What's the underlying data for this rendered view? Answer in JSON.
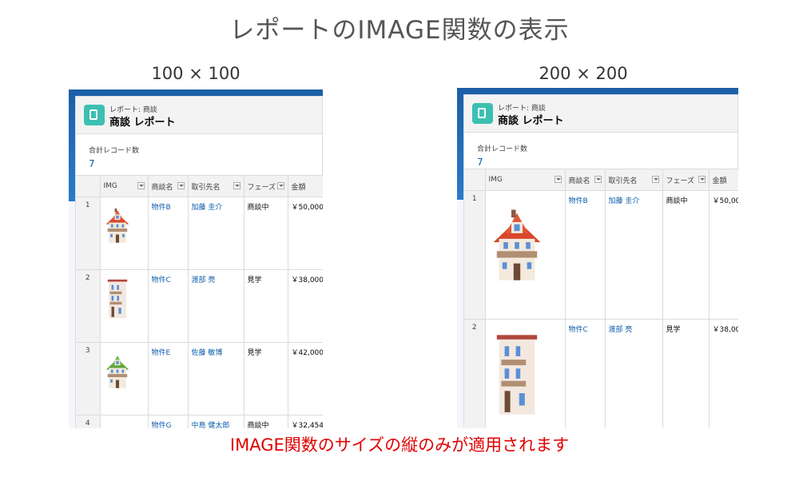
{
  "page": {
    "title": "レポートのIMAGE関数の表示",
    "note": "IMAGE関数のサイズの縦のみが適用されます"
  },
  "panels": [
    {
      "label": "100 × 100",
      "eyebrow": "レポート: 商談",
      "title": "商談 レポート",
      "summary_label": "合計レコード数",
      "summary_value": "7",
      "columns": [
        "IMG",
        "商談名",
        "取引先名",
        "フェーズ",
        "金額"
      ],
      "rows": [
        {
          "no": "1",
          "name": "物件B",
          "account": "加藤 圭介",
          "phase": "商談中",
          "amount": "￥50,000,",
          "house": "red"
        },
        {
          "no": "2",
          "name": "物件C",
          "account": "渡部 亮",
          "phase": "見学",
          "amount": "￥38,000,",
          "house": "tall"
        },
        {
          "no": "3",
          "name": "物件E",
          "account": "佐藤 敏博",
          "phase": "見学",
          "amount": "￥42,000,",
          "house": "green"
        },
        {
          "no": "4",
          "name": "物件G",
          "account": "中島 健太郎",
          "phase": "商談中",
          "amount": "￥32,454,",
          "house": "blue"
        }
      ]
    },
    {
      "label": "200 × 200",
      "eyebrow": "レポート: 商談",
      "title": "商談 レポート",
      "summary_label": "合計レコード数",
      "summary_value": "7",
      "columns": [
        "IMG",
        "商談名",
        "取引先名",
        "フェーズ",
        "金額"
      ],
      "rows": [
        {
          "no": "1",
          "name": "物件B",
          "account": "加藤 圭介",
          "phase": "商談中",
          "amount": "￥50,00",
          "house": "red"
        },
        {
          "no": "2",
          "name": "物件C",
          "account": "渡部 亮",
          "phase": "見学",
          "amount": "￥38,00",
          "house": "tall"
        }
      ]
    }
  ],
  "colors": {
    "link": "#0b5cab",
    "note": "#e00000",
    "badge": "#3cbfb2",
    "frame": "#1b5fa8"
  }
}
